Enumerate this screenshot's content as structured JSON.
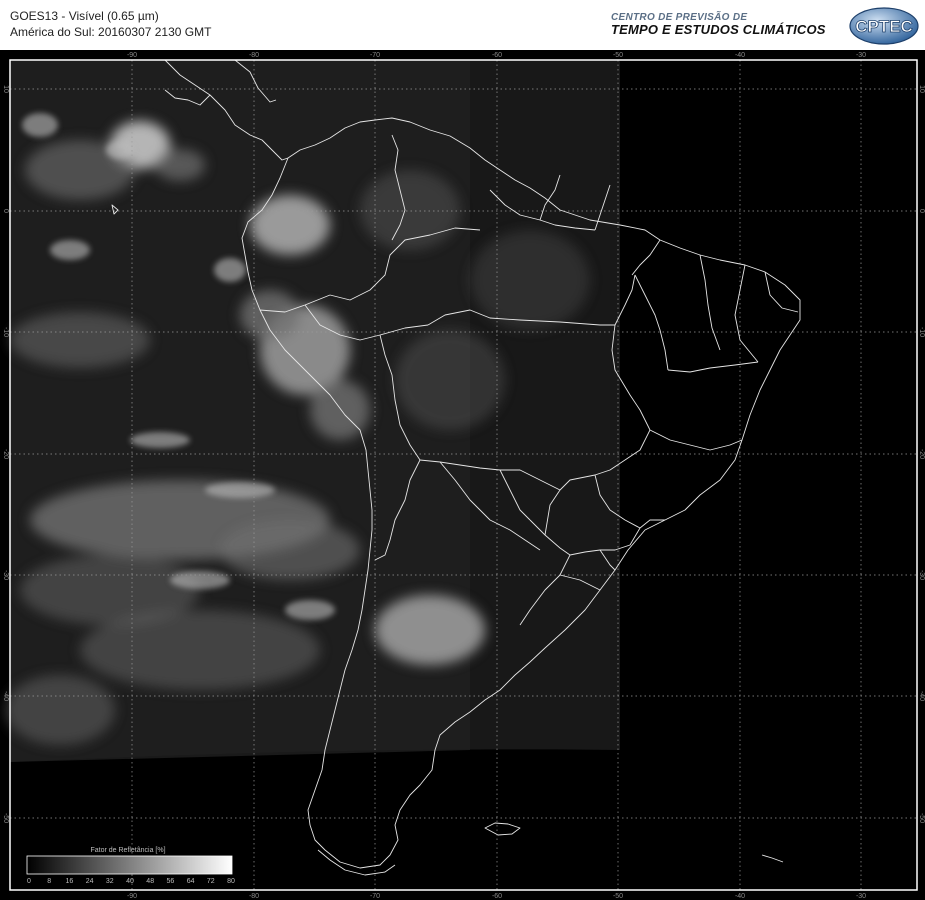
{
  "header": {
    "title_line1": "GOES13 - Visível (0.65 µm)",
    "title_line2": "América do Sul: 20160307 2130 GMT",
    "org_line1": "CENTRO DE PREVISÃO DE",
    "org_line2": "TEMPO E ESTUDOS CLIMÁTICOS",
    "logo_text": "CPTEC"
  },
  "map": {
    "lon_ticks": [
      "-90",
      "-80",
      "-70",
      "-60",
      "-50",
      "-40",
      "-30"
    ],
    "lat_ticks": [
      "10",
      "0",
      "-10",
      "-20",
      "-30",
      "-40",
      "-50"
    ],
    "colors": {
      "background": "#000000",
      "grid": "#9a9a9a",
      "coastline": "#e6e6e6",
      "frame": "#ffffff"
    }
  },
  "legend": {
    "title": "Fator de Refletância [%]",
    "ticks": [
      "0",
      "8",
      "16",
      "24",
      "32",
      "40",
      "48",
      "56",
      "64",
      "72",
      "80"
    ]
  }
}
